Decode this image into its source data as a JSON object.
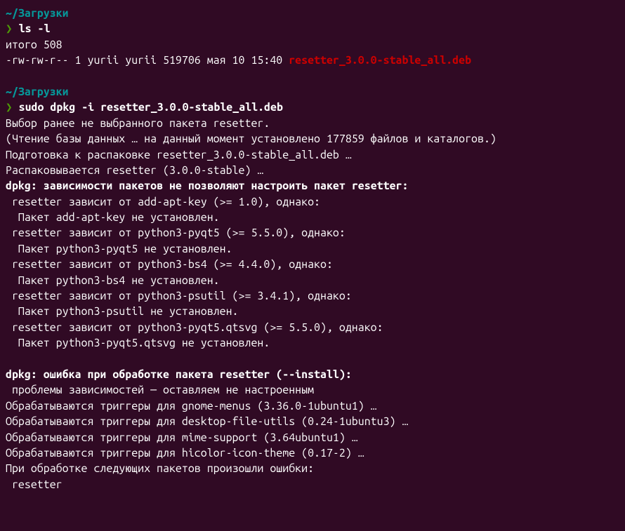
{
  "block1_cwd": "~/Загрузки",
  "block1_prompt": "❯",
  "block1_cmd": "ls -l",
  "block1_out_total": "итого 508",
  "block1_out_perm": "-rw-rw-r-- 1 yurii yurii 519706 мая 10 15:40 ",
  "block1_file": "resetter_3.0.0-stable_all.deb",
  "block2_cwd": "~/Загрузки",
  "block2_prompt": "❯",
  "block2_cmd": "sudo dpkg -i resetter_3.0.0-stable_all.deb",
  "out_01": "Выбор ранее не выбранного пакета resetter.",
  "out_02": "(Чтение базы данных … на данный момент установлено 177859 файлов и каталогов.)",
  "out_03": "Подготовка к распаковке resetter_3.0.0-stable_all.deb …",
  "out_04": "Распаковывается resetter (3.0.0-stable) …",
  "out_05a": "dpkg:",
  "out_05b": " зависимости пакетов не позволяют настроить пакет resetter:",
  "out_06": " resetter зависит от add-apt-key (>= 1.0), однако:",
  "out_07": "  Пакет add-apt-key не установлен.",
  "out_08": " resetter зависит от python3-pyqt5 (>= 5.5.0), однако:",
  "out_09": "  Пакет python3-pyqt5 не установлен.",
  "out_10": " resetter зависит от python3-bs4 (>= 4.4.0), однако:",
  "out_11": "  Пакет python3-bs4 не установлен.",
  "out_12": " resetter зависит от python3-psutil (>= 3.4.1), однако:",
  "out_13": "  Пакет python3-psutil не установлен.",
  "out_14": " resetter зависит от python3-pyqt5.qtsvg (>= 5.5.0), однако:",
  "out_15": "  Пакет python3-pyqt5.qtsvg не установлен.",
  "out_17a": "dpkg:",
  "out_17b": " ошибка при обработке пакета resetter (--install):",
  "out_18": " проблемы зависимостей — оставляем не настроенным",
  "out_19": "Обрабатываются триггеры для gnome-menus (3.36.0-1ubuntu1) …",
  "out_20": "Обрабатываются триггеры для desktop-file-utils (0.24-1ubuntu3) …",
  "out_21": "Обрабатываются триггеры для mime-support (3.64ubuntu1) …",
  "out_22": "Обрабатываются триггеры для hicolor-icon-theme (0.17-2) …",
  "out_23": "При обработке следующих пакетов произошли ошибки:",
  "out_24": " resetter"
}
